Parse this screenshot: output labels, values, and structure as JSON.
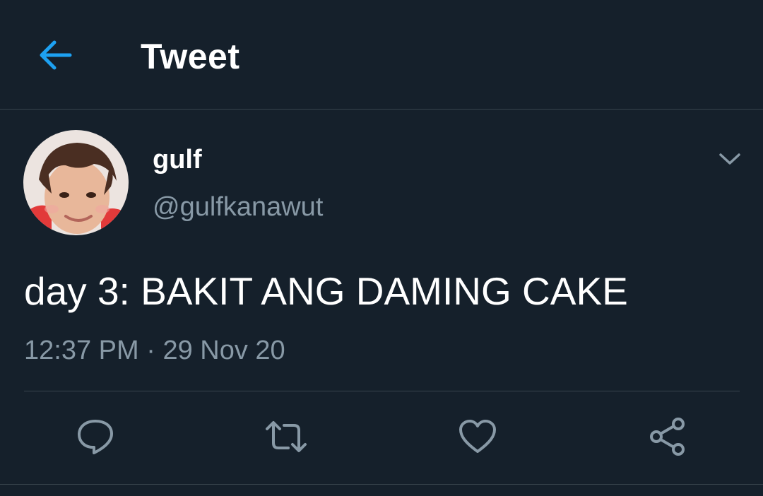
{
  "header": {
    "back_icon": "arrow-left-icon",
    "title": "Tweet"
  },
  "tweet": {
    "author": {
      "display_name": "gulf",
      "handle": "@gulfkanawut",
      "avatar": "profile-photo"
    },
    "menu_icon": "chevron-down-icon",
    "text": "day 3: BAKIT ANG DAMING CAKE",
    "time": "12:37 PM",
    "separator": "·",
    "date": "29 Nov 20"
  },
  "actions": [
    {
      "name": "reply",
      "icon": "reply-icon"
    },
    {
      "name": "retweet",
      "icon": "retweet-icon"
    },
    {
      "name": "like",
      "icon": "heart-icon"
    },
    {
      "name": "share",
      "icon": "share-icon"
    }
  ],
  "colors": {
    "background": "#15202b",
    "accent": "#1da1f2",
    "secondary_text": "#8899a6",
    "divider": "#38444d"
  }
}
